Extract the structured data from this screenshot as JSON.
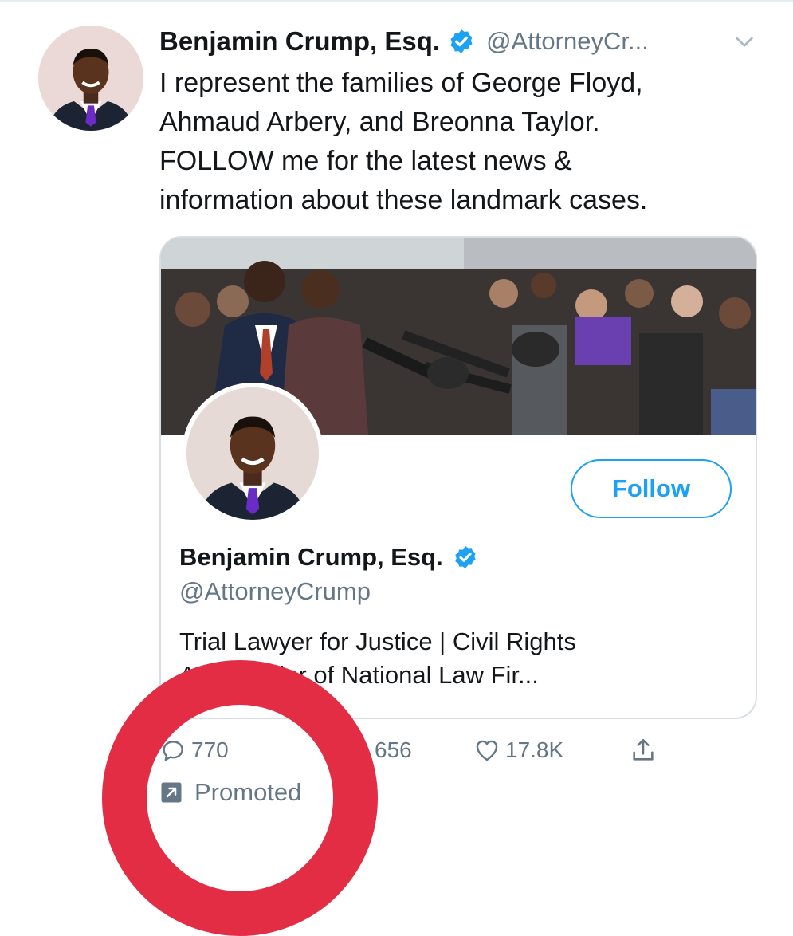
{
  "tweet": {
    "display_name": "Benjamin Crump, Esq.",
    "handle": "@AttorneyCr...",
    "text_lines": [
      "I represent the families of George Floyd,",
      "Ahmaud Arbery, and Breonna Taylor.",
      "FOLLOW me for the latest news &",
      "information about these landmark cases."
    ]
  },
  "card": {
    "follow_label": "Follow",
    "display_name": "Benjamin Crump, Esq.",
    "handle": "@AttorneyCrump",
    "bio_lines": [
      "Trial Lawyer for Justice | Civil Rights",
      "A          | Founder of National Law Fir..."
    ]
  },
  "actions": {
    "reply_count": "770",
    "retweet_count": "656",
    "like_count": "17.8K"
  },
  "promoted_label": "Promoted",
  "icons": {
    "verified": "verified-badge-icon",
    "chevron": "chevron-down-icon",
    "reply": "reply-icon",
    "like": "heart-icon",
    "share": "share-icon",
    "promoted": "promoted-arrow-icon"
  },
  "colors": {
    "accent": "#1da1f2",
    "text": "#14171a",
    "muted": "#657786",
    "annotation": "#e32d45"
  }
}
